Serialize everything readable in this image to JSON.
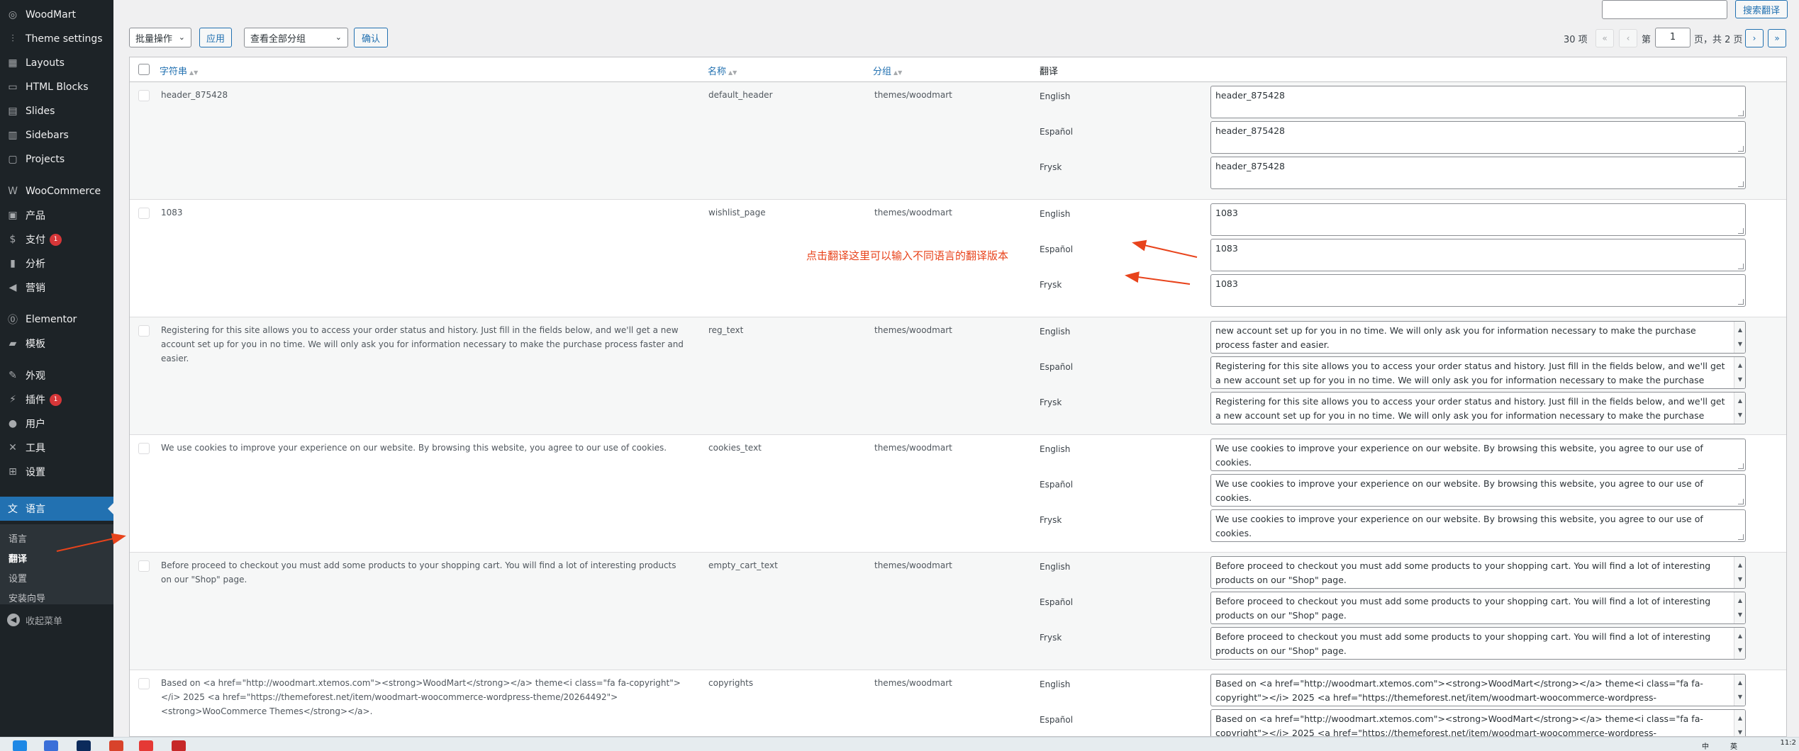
{
  "sidebar": {
    "items": [
      {
        "label": "WoodMart",
        "icon": "woodmart-icon",
        "glyph": "◎"
      },
      {
        "label": "Theme settings",
        "icon": "sliders-icon",
        "glyph": "⫶"
      },
      {
        "label": "Layouts",
        "icon": "layouts-icon",
        "glyph": "▦"
      },
      {
        "label": "HTML Blocks",
        "icon": "html-blocks-icon",
        "glyph": "▭"
      },
      {
        "label": "Slides",
        "icon": "slides-icon",
        "glyph": "▤"
      },
      {
        "label": "Sidebars",
        "icon": "sidebars-icon",
        "glyph": "▥"
      },
      {
        "label": "Projects",
        "icon": "projects-icon",
        "glyph": "▢"
      },
      {
        "label": "WooCommerce",
        "icon": "woocommerce-icon",
        "glyph": "W"
      },
      {
        "label": "产品",
        "icon": "archive-icon",
        "glyph": "▣"
      },
      {
        "label": "支付",
        "icon": "payment-icon",
        "glyph": "$",
        "badge": "1"
      },
      {
        "label": "分析",
        "icon": "chart-icon",
        "glyph": "▮"
      },
      {
        "label": "营销",
        "icon": "megaphone-icon",
        "glyph": "◀"
      },
      {
        "label": "Elementor",
        "icon": "elementor-icon",
        "glyph": "⓪"
      },
      {
        "label": "模板",
        "icon": "folder-icon",
        "glyph": "▰"
      },
      {
        "label": "外观",
        "icon": "brush-icon",
        "glyph": "✎"
      },
      {
        "label": "插件",
        "icon": "plugin-icon",
        "glyph": "⚡",
        "badge": "1"
      },
      {
        "label": "用户",
        "icon": "user-icon",
        "glyph": "●"
      },
      {
        "label": "工具",
        "icon": "wrench-icon",
        "glyph": "✕"
      },
      {
        "label": "设置",
        "icon": "settings-icon",
        "glyph": "⊞"
      },
      {
        "label": "语言",
        "icon": "translation-icon",
        "glyph": "文"
      }
    ],
    "submenu": [
      "语言",
      "翻译",
      "设置",
      "安装向导"
    ],
    "collapse_label": "收起菜单"
  },
  "toolbar": {
    "bulk_action": "批量操作",
    "apply": "应用",
    "group_filter": "查看全部分组",
    "confirm": "确认",
    "search_value": "",
    "search_button": "搜索翻译"
  },
  "pagination": {
    "total_items": "30 项",
    "first": "«",
    "prev": "‹",
    "page_prefix": "第",
    "current_page": "1",
    "page_suffix": "页，共 2 页",
    "next": "›",
    "last": "»"
  },
  "table": {
    "columns": {
      "string": "字符串",
      "name": "名称",
      "group": "分组",
      "translation": "翻译"
    },
    "languages": [
      "English",
      "Español",
      "Frysk"
    ],
    "rows": [
      {
        "string": "header_875428",
        "name": "default_header",
        "group": "themes/woodmart",
        "translations": [
          "header_875428",
          "header_875428",
          "header_875428"
        ]
      },
      {
        "string": "1083",
        "name": "wishlist_page",
        "group": "themes/woodmart",
        "translations": [
          "1083",
          "1083",
          "1083"
        ]
      },
      {
        "string": "Registering for this site allows you to access your order status and history. Just fill in the fields below, and we'll get a new account set up for you in no time. We will only ask you for information necessary to make the purchase process faster and easier.",
        "name": "reg_text",
        "group": "themes/woodmart",
        "translations": [
          "new account set up for you in no time. We will only ask you for information necessary to make the purchase process faster and easier.",
          "Registering for this site allows you to access your order status and history. Just fill in the fields below, and we'll get a new account set up for you in no time. We will only ask you for information necessary to make the purchase process",
          "Registering for this site allows you to access your order status and history. Just fill in the fields below, and we'll get a new account set up for you in no time. We will only ask you for information necessary to make the purchase process"
        ]
      },
      {
        "string": "We use cookies to improve your experience on our website. By browsing this website, you agree to our use of cookies.",
        "name": "cookies_text",
        "group": "themes/woodmart",
        "translations": [
          "We use cookies to improve your experience on our website. By browsing this website, you agree to our use of cookies.",
          "We use cookies to improve your experience on our website. By browsing this website, you agree to our use of cookies.",
          "We use cookies to improve your experience on our website. By browsing this website, you agree to our use of cookies."
        ]
      },
      {
        "string": "Before proceed to checkout you must add some products to your shopping cart. You will find a lot of interesting products on our \"Shop\" page.",
        "name": "empty_cart_text",
        "group": "themes/woodmart",
        "translations": [
          "Before proceed to checkout you must add some products to your shopping cart. You will find a lot of interesting products on our \"Shop\" page.",
          "Before proceed to checkout you must add some products to your shopping cart. You will find a lot of interesting products on our \"Shop\" page.",
          "Before proceed to checkout you must add some products to your shopping cart. You will find a lot of interesting products on our \"Shop\" page."
        ]
      },
      {
        "string": "Based on <a href=\"http://woodmart.xtemos.com\"><strong>WoodMart</strong></a> theme<i class=\"fa fa-copyright\"></i> 2025 <a href=\"https://themeforest.net/item/woodmart-woocommerce-wordpress-theme/20264492\"><strong>WooCommerce Themes</strong></a>.",
        "name": "copyrights",
        "group": "themes/woodmart",
        "translations": [
          "Based on <a href=\"http://woodmart.xtemos.com\"><strong>WoodMart</strong></a> theme<i class=\"fa fa-copyright\"></i> 2025 <a href=\"https://themeforest.net/item/woodmart-woocommerce-wordpress-",
          "Based on <a href=\"http://woodmart.xtemos.com\"><strong>WoodMart</strong></a> theme<i class=\"fa fa-copyright\"></i> 2025 <a href=\"https://themeforest.net/item/woodmart-woocommerce-wordpress-",
          ""
        ]
      }
    ]
  },
  "annotation": {
    "text": "点击翻译这里可以输入不同语言的翻译版本",
    "color": "#e8431b"
  },
  "taskbar": {
    "clock": "11:2",
    "tray": [
      "中",
      "英"
    ]
  },
  "colors": {
    "sidebar_bg": "#1d2327",
    "accent": "#2271b1",
    "badge": "#d63638",
    "page_bg": "#f0f0f1"
  }
}
